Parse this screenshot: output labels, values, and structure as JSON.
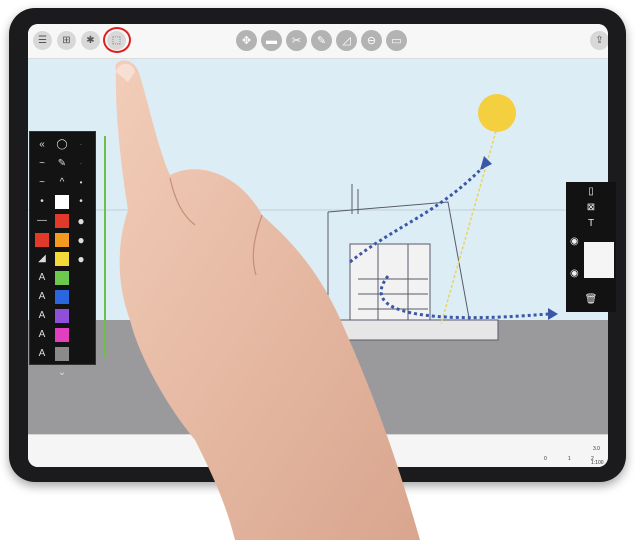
{
  "app": {
    "accent_highlight": "#e02020",
    "toolbar_left": [
      {
        "name": "list-icon",
        "glyph": "☰"
      },
      {
        "name": "grid-icon",
        "glyph": "⊞"
      },
      {
        "name": "wrench-icon",
        "glyph": "🔧"
      },
      {
        "name": "frame-icon",
        "glyph": "⬚"
      }
    ],
    "toolbar_center": [
      {
        "name": "navigate-icon",
        "glyph": "✥"
      },
      {
        "name": "eraser-icon",
        "glyph": "▬"
      },
      {
        "name": "scissors-icon",
        "glyph": "✂"
      },
      {
        "name": "pencil-icon",
        "glyph": "✎"
      },
      {
        "name": "triangle-ruler-icon",
        "glyph": "◿"
      },
      {
        "name": "layers-circle-icon",
        "glyph": "⊖"
      },
      {
        "name": "sheet-icon",
        "glyph": "▭"
      }
    ],
    "toolbar_right": {
      "name": "share-icon",
      "glyph": "⇪"
    },
    "palette": {
      "colors": [
        "#ffffff",
        "#e23a2a",
        "#f39a21",
        "#f5d93a",
        "#6cc94d",
        "#2a67de",
        "#8f4fd8",
        "#e23fbf",
        "#8a8a8a"
      ],
      "top_icons": [
        "«",
        "◯",
        "✎",
        "✎"
      ],
      "tools": [
        "⊔",
        "A",
        "A",
        "A",
        "A",
        "A",
        "A"
      ]
    },
    "scale_bar": {
      "left": "0",
      "mid": "1",
      "right": "2",
      "far": "3.0",
      "unit": "1:100"
    },
    "layers_panel": {
      "icons": [
        "doc-icon",
        "image-icon",
        "text-icon",
        "eye-icon",
        "eye-icon",
        "trash-icon"
      ]
    }
  }
}
